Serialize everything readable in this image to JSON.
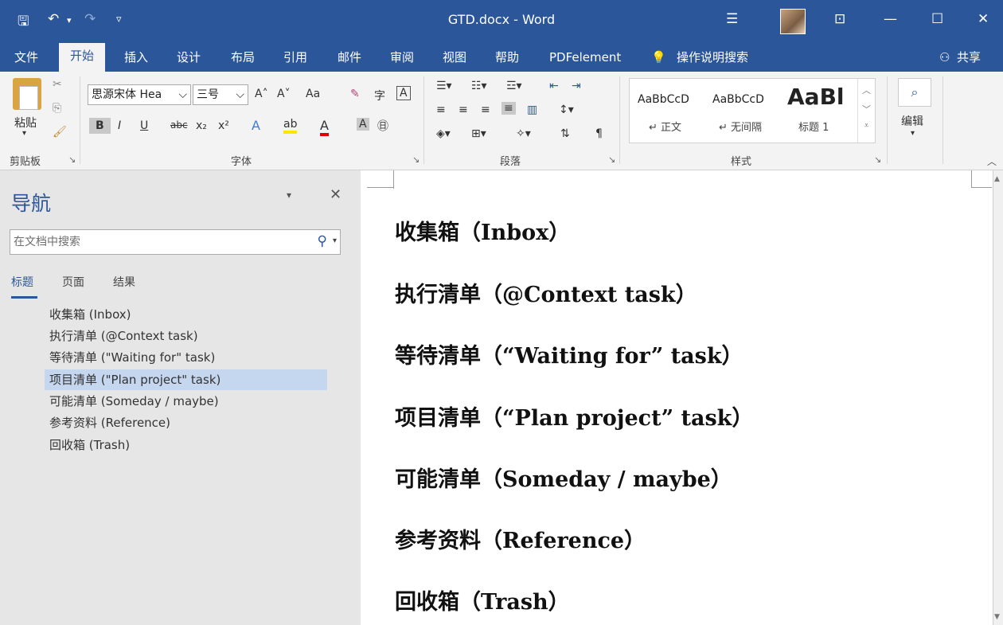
{
  "title_bar": {
    "title": "GTD.docx - Word",
    "quick_access": {
      "save": "🖫",
      "undo": "↶",
      "undo_dd": "▾",
      "redo": "↷",
      "customize": "▿"
    },
    "options_icon": "☰",
    "ribbon_display": "⊡",
    "minimize": "—",
    "maximize": "☐",
    "close": "✕"
  },
  "menu": {
    "tabs": [
      "文件",
      "开始",
      "插入",
      "设计",
      "布局",
      "引用",
      "邮件",
      "审阅",
      "视图",
      "帮助",
      "PDFelement"
    ],
    "active_tab": "开始",
    "tell_me": "操作说明搜索",
    "share": "共享"
  },
  "ribbon": {
    "clipboard": {
      "group_label": "剪贴板",
      "paste": "粘贴"
    },
    "font": {
      "group_label": "字体",
      "font_name": "思源宋体 Hea",
      "font_size": "三号",
      "grow": "A˄",
      "shrink": "A˅",
      "change_case": "Aa",
      "bold": "B",
      "italic": "I",
      "underline": "U",
      "strikethrough": "abc",
      "subscript": "x₂",
      "superscript": "x²",
      "text_effects": "A",
      "highlight": "ab",
      "font_color": "A",
      "char_shading": "A",
      "enclose": "㊐"
    },
    "paragraph": {
      "group_label": "段落"
    },
    "styles": {
      "group_label": "样式",
      "items": [
        {
          "sample": "AaBbCcD",
          "name": "↵ 正文"
        },
        {
          "sample": "AaBbCcD",
          "name": "↵ 无间隔"
        },
        {
          "sample": "AaBl",
          "name": "标题 1"
        }
      ]
    },
    "editing": {
      "label": "编辑"
    }
  },
  "navigation": {
    "title": "导航",
    "search_placeholder": "在文档中搜索",
    "tabs": [
      "标题",
      "页面",
      "结果"
    ],
    "active_tab": "标题",
    "headings": [
      "收集箱 (Inbox)",
      "执行清单 (@Context task)",
      "等待清单 (\"Waiting for\" task)",
      "项目清单 (\"Plan project\" task)",
      "可能清单 (Someday / maybe)",
      "参考资料 (Reference)",
      "回收箱 (Trash)"
    ],
    "selected_index": 3
  },
  "document": {
    "headings": [
      "收集箱（Inbox）",
      "执行清单（@Context task）",
      "等待清单（“Waiting for” task）",
      "项目清单（“Plan project” task）",
      "可能清单（Someday / maybe）",
      "参考资料（Reference）",
      "回收箱（Trash）"
    ]
  },
  "colors": {
    "accent": "#2b579a",
    "selection": "#c5d6ef",
    "ribbon_bg": "#f3f3f3",
    "pane_bg": "#e6e6e6"
  }
}
